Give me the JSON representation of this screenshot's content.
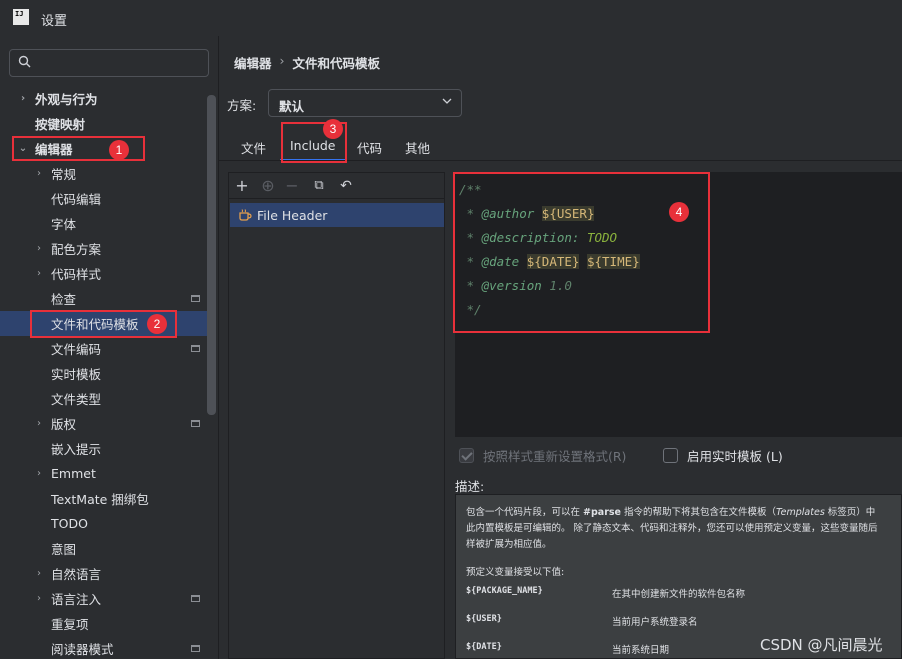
{
  "window": {
    "title": "设置",
    "logo_text": "IJ"
  },
  "search": {
    "placeholder": "",
    "value": ""
  },
  "sidebar": {
    "items": [
      {
        "label": "外观与行为"
      },
      {
        "label": "按键映射"
      },
      {
        "label": "编辑器"
      },
      {
        "label": "常规"
      },
      {
        "label": "代码编辑"
      },
      {
        "label": "字体"
      },
      {
        "label": "配色方案"
      },
      {
        "label": "代码样式"
      },
      {
        "label": "检查"
      },
      {
        "label": "文件和代码模板"
      },
      {
        "label": "文件编码"
      },
      {
        "label": "实时模板"
      },
      {
        "label": "文件类型"
      },
      {
        "label": "版权"
      },
      {
        "label": "嵌入提示"
      },
      {
        "label": "Emmet"
      },
      {
        "label": "TextMate 捆绑包"
      },
      {
        "label": "TODO"
      },
      {
        "label": "意图"
      },
      {
        "label": "自然语言"
      },
      {
        "label": "语言注入"
      },
      {
        "label": "重复项"
      },
      {
        "label": "阅读器模式"
      }
    ]
  },
  "breadcrumb": {
    "parent": "编辑器",
    "separator": "›",
    "current": "文件和代码模板"
  },
  "scheme": {
    "label": "方案:",
    "value": "默认"
  },
  "tabs": [
    {
      "label": "文件"
    },
    {
      "label": "Include"
    },
    {
      "label": "代码"
    },
    {
      "label": "其他"
    }
  ],
  "template_list": {
    "items": [
      {
        "label": "File Header"
      }
    ]
  },
  "editor": {
    "line1": "/**",
    "line2_prefix": " * ",
    "line2_tag": "@author",
    "line2_var": "${USER}",
    "line3_prefix": " * ",
    "line3_tag": "@description:",
    "line3_todo": "TODO",
    "line4_prefix": " * ",
    "line4_tag": "@date",
    "line4_var1": "${DATE}",
    "line4_var2": "${TIME}",
    "line5_prefix": " * ",
    "line5_tag": "@version",
    "line5_value": "1.0",
    "line6": " */"
  },
  "options": {
    "reformat_label": "按照样式重新设置格式(R)",
    "live_template_label": "启用实时模板 (L)"
  },
  "description": {
    "label": "描述:",
    "p1_a": "包含一个代码片段，可以在 ",
    "p1_parse": "#parse",
    "p1_b": " 指令的帮助下将其包含在文件模板（",
    "p1_templates": "Templates",
    "p1_c": " 标签页）中",
    "p1_d": "此内置模板是可编辑的。 除了静态文本、代码和注释外，您还可以使用预定义变量，这些变量随后",
    "p1_e": "样被扩展为相应值。",
    "p2": "预定义变量接受以下值:",
    "vars": [
      {
        "name": "${PACKAGE_NAME}",
        "desc": "在其中创建新文件的软件包名称"
      },
      {
        "name": "${USER}",
        "desc": "当前用户系统登录名"
      },
      {
        "name": "${DATE}",
        "desc": "当前系统日期"
      }
    ]
  },
  "annotations": [
    "1",
    "2",
    "3",
    "4"
  ],
  "watermark": "CSDN @凡间晨光",
  "colors": {
    "accent": "#3574f0",
    "selection": "#2e436e",
    "annotation": "#e8303a"
  }
}
